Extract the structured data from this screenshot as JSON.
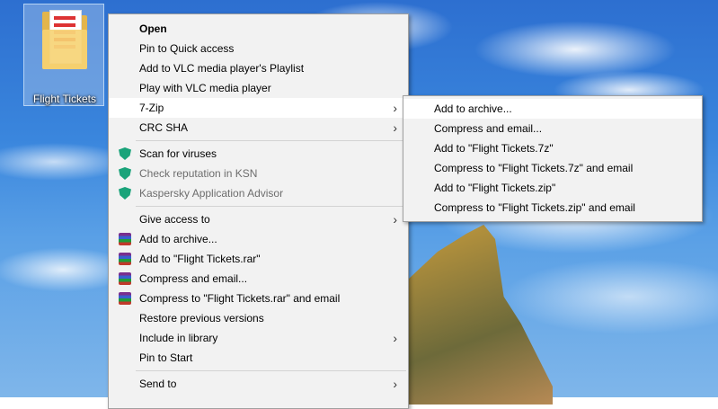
{
  "desktop": {
    "icon_label": "Flight Tickets"
  },
  "context_menu": {
    "items": [
      {
        "label": "Open"
      },
      {
        "label": "Pin to Quick access"
      },
      {
        "label": "Add to VLC media player's Playlist"
      },
      {
        "label": "Play with VLC media player"
      },
      {
        "label": "7-Zip"
      },
      {
        "label": "CRC SHA"
      },
      {
        "label": "Scan for viruses"
      },
      {
        "label": "Check reputation in KSN"
      },
      {
        "label": "Kaspersky Application Advisor"
      },
      {
        "label": "Give access to"
      },
      {
        "label": "Add to archive..."
      },
      {
        "label": "Add to \"Flight Tickets.rar\""
      },
      {
        "label": "Compress and email..."
      },
      {
        "label": "Compress to \"Flight Tickets.rar\" and email"
      },
      {
        "label": "Restore previous versions"
      },
      {
        "label": "Include in library"
      },
      {
        "label": "Pin to Start"
      },
      {
        "label": "Send to"
      }
    ]
  },
  "submenu_7zip": {
    "items": [
      {
        "label": "Add to archive..."
      },
      {
        "label": "Compress and email..."
      },
      {
        "label": "Add to \"Flight Tickets.7z\""
      },
      {
        "label": "Compress to \"Flight Tickets.7z\" and email"
      },
      {
        "label": "Add to \"Flight Tickets.zip\""
      },
      {
        "label": "Compress to \"Flight Tickets.zip\" and email"
      }
    ]
  },
  "icons": {
    "submenu_arrow": "chevron-right-icon",
    "kaspersky": "shield-icon",
    "winrar": "winrar-icon",
    "folder": "folder-icon"
  },
  "colors": {
    "kaspersky_shield": "#1aa37a",
    "menu_bg": "#f2f2f2",
    "hover_bg": "#ffffff"
  }
}
